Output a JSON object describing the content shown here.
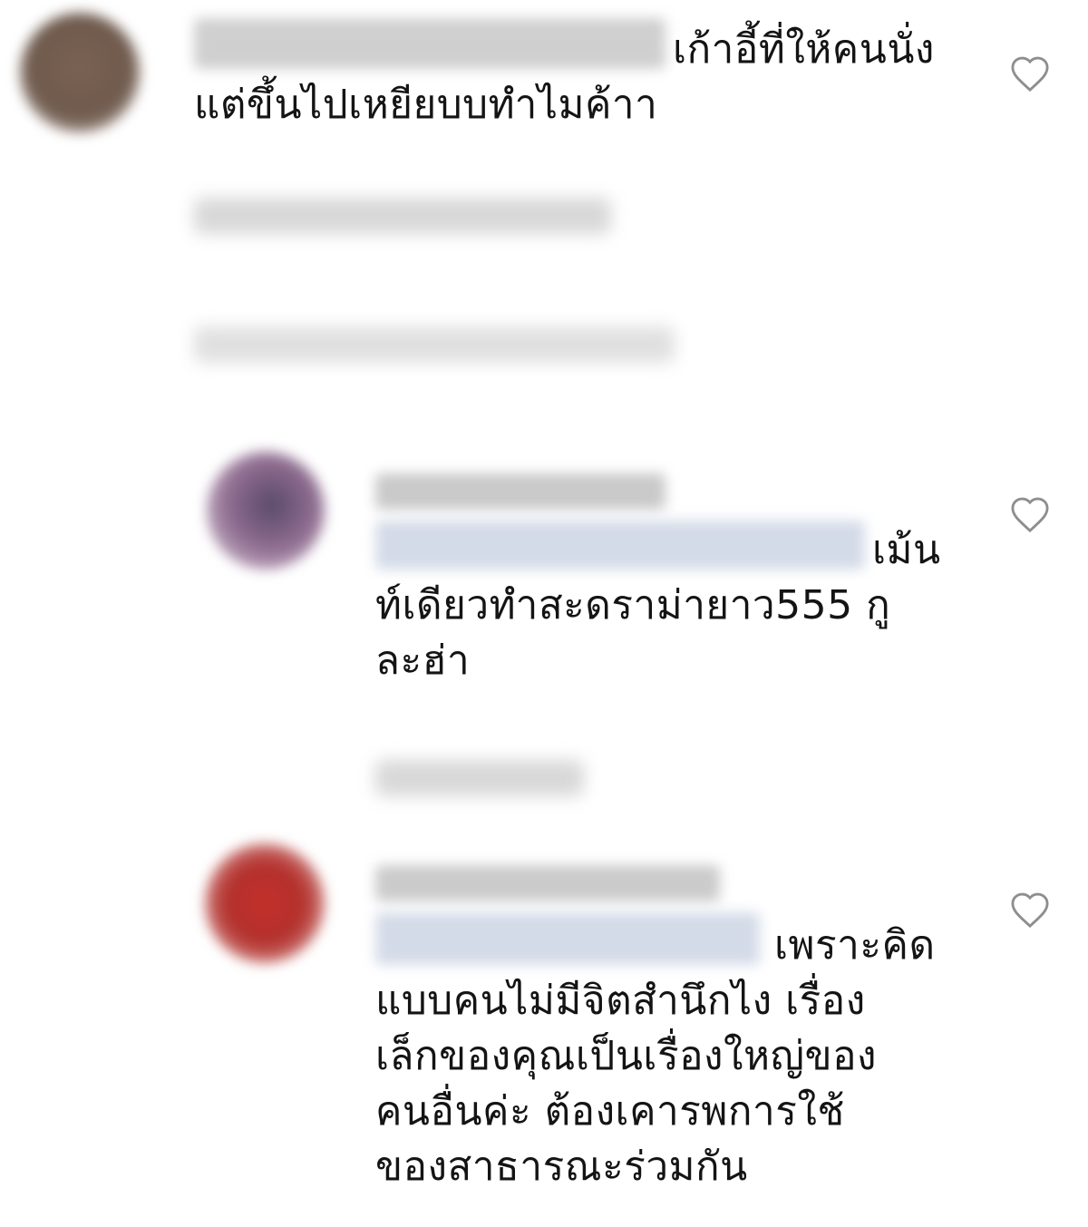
{
  "comments": [
    {
      "text": "เก้าอี้ที่ให้คนนั่ง\nแต่ขึ้นไปเหยียบบทำไมค้าา",
      "avatar_color": "#7a6252",
      "like_icon": "heart-outline-icon"
    },
    {
      "text": "เม้น\nท์เดียวทำสะดราม่ายาว555 กู\nละฮ่า",
      "avatar_color": "#8c6a8e",
      "like_icon": "heart-outline-icon"
    },
    {
      "text": "เพราะคิด\nแบบคนไม่มีจิตสำนึกไง เรื่อง\nเล็กของคุณเป็นเรื่องใหญ่ของ\nคนอื่นค่ะ ต้องเคารพการใช้\nของสาธารณะร่วมกัน",
      "avatar_color": "#b3302c",
      "like_icon": "heart-outline-icon"
    }
  ]
}
